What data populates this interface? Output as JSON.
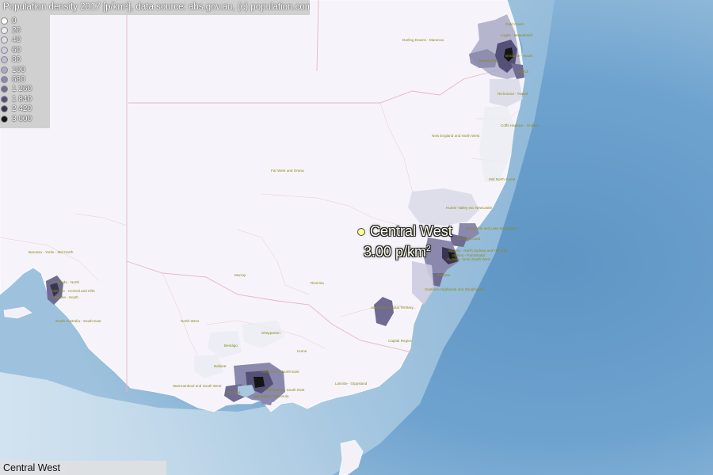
{
  "map": {
    "title": "Population density 2017 [p/km²], data source: abs.gov.au, (c) population.com.au",
    "legend": [
      {
        "label": "0",
        "color": "#ffffff"
      },
      {
        "label": "20",
        "color": "#ececf4"
      },
      {
        "label": "40",
        "color": "#dcdce9"
      },
      {
        "label": "60",
        "color": "#ccccdf"
      },
      {
        "label": "80",
        "color": "#bbbbd4"
      },
      {
        "label": "100",
        "color": "#a9a9c6"
      },
      {
        "label": "680",
        "color": "#8b88ad"
      },
      {
        "label": "1 260",
        "color": "#6f6b92"
      },
      {
        "label": "1 840",
        "color": "#545077"
      },
      {
        "label": "2 420",
        "color": "#38354f"
      },
      {
        "label": "3 000",
        "color": "#141414"
      }
    ],
    "selected_region": {
      "name": "Central West",
      "value": "3.00 p/km",
      "unit_sup": "2"
    },
    "status_text": "Central West",
    "colors": {
      "ocean": "#b3cfe0",
      "ocean_deep": "#5e95c4",
      "land": "#f6f4fa",
      "border": "#e6b6c6",
      "label": "#8b8b1a"
    },
    "region_labels": {
      "gold_coast": "Gold Coast",
      "darling_downs": "Darling Downs - Maranoa",
      "logan": "Logan - Beaudesert",
      "brisbane_south": "Brisbane - South",
      "toowoomba": "Toowoomba",
      "ipswich": "Ipswich",
      "richmond_tweed": "Richmond - Tweed",
      "coffs_harbour": "Coffs Harbour - Grafton",
      "new_england": "New England and North West",
      "far_west": "Far West and Orana",
      "mid_north_coast": "Mid North Coast",
      "hunter_valley": "Hunter Valley exc Newcastle",
      "newcastle": "Newcastle and Lake Macquarie",
      "central_coast": "Central Coast",
      "sydney_north": "Sydney - North Sydney and Hornsby",
      "parramatta": "Sydney - Parramatta",
      "inner_south_west": "Sydney - Inner South West",
      "illawarra": "Illawarra",
      "southern_highlands": "Southern Highlands and Shoalhaven",
      "barossa": "Barossa - Yorke - Mid North",
      "adelaide_north": "Adelaide - North",
      "adelaide_central": "Adelaide - Central and Hills",
      "adelaide_south": "Adelaide - South",
      "murray": "Murray",
      "riverina": "Riverina",
      "act": "Australian Capital Territory",
      "sa_south_east": "South Australia - South East",
      "north_west": "North West",
      "shepparton": "Shepparton",
      "capital_region": "Capital Region",
      "hume": "Hume",
      "bendigo": "Bendigo",
      "ballarat": "Ballarat",
      "melbourne_north_east": "Melbourne - North East",
      "warrnambool": "Warrnambool and South West",
      "geelong": "Geelong",
      "melbourne_south_east": "Melbourne - South East",
      "mornington": "Mornington Peninsula",
      "latrobe": "Latrobe - Gippsland"
    }
  }
}
